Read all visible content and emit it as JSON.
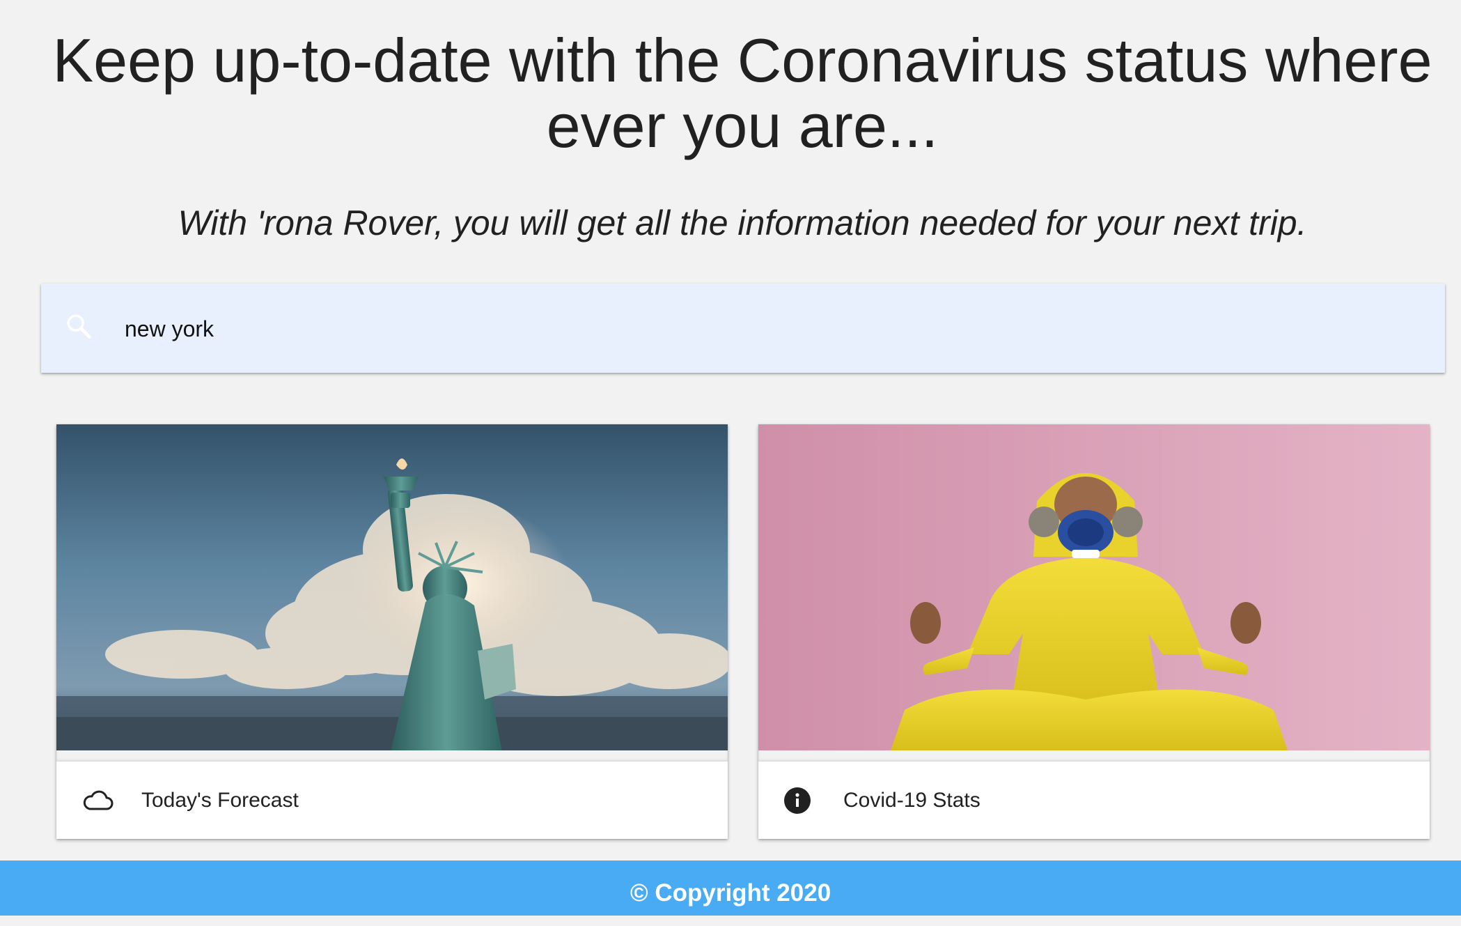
{
  "hero": {
    "title": "Keep up-to-date with the Coronavirus status where ever you are...",
    "subtitle": "With 'rona Rover, you will get all the information needed for your next trip."
  },
  "search": {
    "value": "new york",
    "icon": "search-icon"
  },
  "cards": [
    {
      "label": "Today's Forecast",
      "icon": "cloud-icon",
      "image": "statue-of-liberty-photo"
    },
    {
      "label": "Covid-19 Stats",
      "icon": "info-icon",
      "image": "hazmat-suit-person-photo"
    }
  ],
  "footer": {
    "copyright": "© Copyright 2020"
  },
  "colors": {
    "background": "#f2f2f2",
    "search_bar": "#e8effd",
    "footer": "#4aabf5",
    "text": "#212121"
  }
}
